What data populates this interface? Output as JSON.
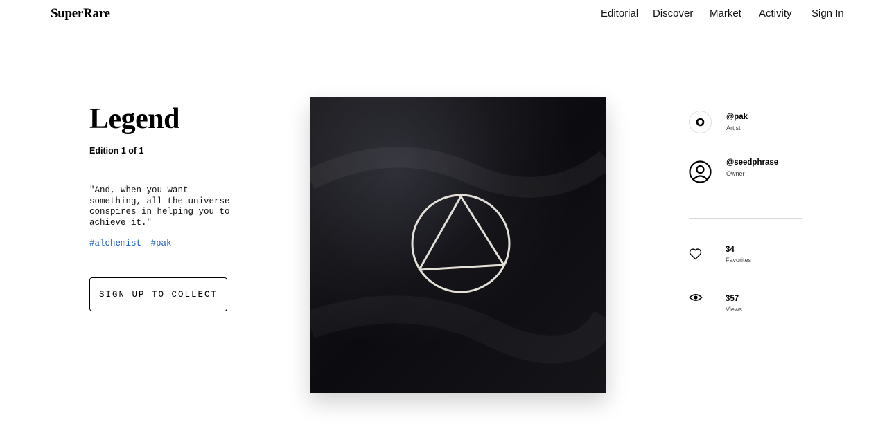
{
  "header": {
    "logo": "SuperRare",
    "nav": [
      "Editorial",
      "Discover",
      "Market",
      "Activity",
      "Sign In"
    ]
  },
  "artwork": {
    "title": "Legend",
    "edition": "Edition 1 of 1",
    "description": "\"And, when you want something, all the universe conspires in helping you to achieve it.\"",
    "tags": [
      "#alchemist",
      "#pak"
    ],
    "collect_label": "SIGN UP TO COLLECT"
  },
  "people": {
    "artist": {
      "handle": "@pak",
      "role": "Artist"
    },
    "owner": {
      "handle": "@seedphrase",
      "role": "Owner"
    }
  },
  "stats": {
    "favorites": {
      "value": "34",
      "label": "Favorites"
    },
    "views": {
      "value": "357",
      "label": "Views"
    }
  },
  "colors": {
    "accent": "#1a5fc7",
    "art_bg": "#111118",
    "symbol": "#e4e0d8"
  }
}
